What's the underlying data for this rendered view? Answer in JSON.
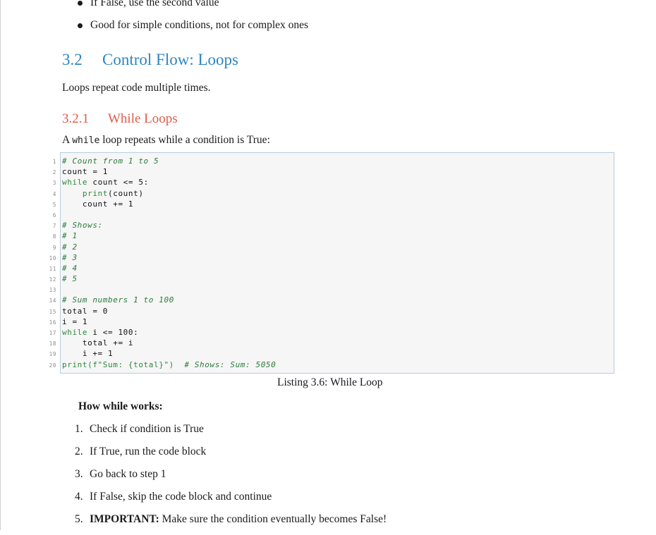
{
  "bullets": [
    "If False, use the second value",
    "Good for simple conditions, not for complex ones"
  ],
  "section": {
    "number": "3.2",
    "title": "Control Flow: Loops"
  },
  "section_intro": "Loops repeat code multiple times.",
  "subsection": {
    "number": "3.2.1",
    "title": "While Loops"
  },
  "intro": {
    "before": "A ",
    "code": "while",
    "after": " loop repeats while a condition is True:"
  },
  "code": [
    {
      "n": "1",
      "text": "# Count from 1 to 5",
      "cls": "cm"
    },
    {
      "n": "2",
      "text": "count = 1",
      "cls": "ctext"
    },
    {
      "n": "3",
      "kw": "while",
      "text": " count <= 5:",
      "cls": "ctext"
    },
    {
      "n": "4",
      "indent": "    ",
      "kw": "print",
      "text": "(count)",
      "cls": "ctext"
    },
    {
      "n": "5",
      "text": "    count += 1",
      "cls": "ctext"
    },
    {
      "n": "6",
      "text": "",
      "cls": "ctext"
    },
    {
      "n": "7",
      "text": "# Shows:",
      "cls": "cm"
    },
    {
      "n": "8",
      "text": "# 1",
      "cls": "cm"
    },
    {
      "n": "9",
      "text": "# 2",
      "cls": "cm"
    },
    {
      "n": "10",
      "text": "# 3",
      "cls": "cm"
    },
    {
      "n": "11",
      "text": "# 4",
      "cls": "cm"
    },
    {
      "n": "12",
      "text": "# 5",
      "cls": "cm"
    },
    {
      "n": "13",
      "text": "",
      "cls": "ctext"
    },
    {
      "n": "14",
      "text": "# Sum numbers 1 to 100",
      "cls": "cm"
    },
    {
      "n": "15",
      "text": "total = 0",
      "cls": "ctext"
    },
    {
      "n": "16",
      "text": "i = 1",
      "cls": "ctext"
    },
    {
      "n": "17",
      "kw": "while",
      "text": " i <= 100:",
      "cls": "ctext"
    },
    {
      "n": "18",
      "text": "    total += i",
      "cls": "ctext"
    },
    {
      "n": "19",
      "text": "    i += 1",
      "cls": "ctext"
    },
    {
      "n": "20",
      "kw": "print(f\"Sum: {total}\")",
      "text": "  ",
      "comment": "# Shows: Sum: 5050",
      "cls": "ctext"
    }
  ],
  "caption": "Listing 3.6: While Loop",
  "how_title": "How while works:",
  "steps": [
    {
      "n": "1.",
      "text": "Check if condition is True"
    },
    {
      "n": "2.",
      "text": "If True, run the code block"
    },
    {
      "n": "3.",
      "text": "Go back to step 1"
    },
    {
      "n": "4.",
      "text": "If False, skip the code block and continue"
    },
    {
      "n": "5.",
      "bold": "IMPORTANT:",
      "text": " Make sure the condition eventually becomes False!"
    }
  ]
}
